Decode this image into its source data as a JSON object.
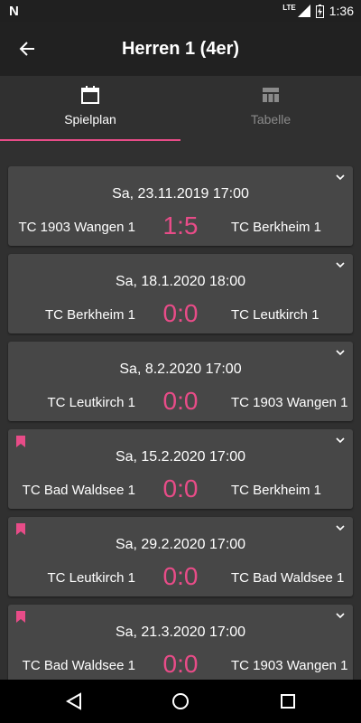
{
  "status": {
    "time": "1:36",
    "network": "LTE"
  },
  "header": {
    "title": "Herren 1 (4er)"
  },
  "tabs": [
    {
      "label": "Spielplan",
      "icon": "calendar-icon",
      "active": true
    },
    {
      "label": "Tabelle",
      "icon": "table-icon",
      "active": false
    }
  ],
  "accent": "#e84c88",
  "matches": [
    {
      "date": "Sa, 23.11.2019 17:00",
      "home": "TC 1903 Wangen 1",
      "away": "TC Berkheim 1",
      "score": "1:5",
      "bookmarked": false
    },
    {
      "date": "Sa, 18.1.2020 18:00",
      "home": "TC Berkheim 1",
      "away": "TC Leutkirch 1",
      "score": "0:0",
      "bookmarked": false
    },
    {
      "date": "Sa, 8.2.2020 17:00",
      "home": "TC Leutkirch 1",
      "away": "TC 1903 Wangen 1",
      "score": "0:0",
      "bookmarked": false
    },
    {
      "date": "Sa, 15.2.2020 17:00",
      "home": "TC Bad Waldsee 1",
      "away": "TC Berkheim 1",
      "score": "0:0",
      "bookmarked": true
    },
    {
      "date": "Sa, 29.2.2020 17:00",
      "home": "TC Leutkirch 1",
      "away": "TC Bad Waldsee 1",
      "score": "0:0",
      "bookmarked": true
    },
    {
      "date": "Sa, 21.3.2020 17:00",
      "home": "TC Bad Waldsee 1",
      "away": "TC 1903 Wangen 1",
      "score": "0:0",
      "bookmarked": true
    }
  ]
}
